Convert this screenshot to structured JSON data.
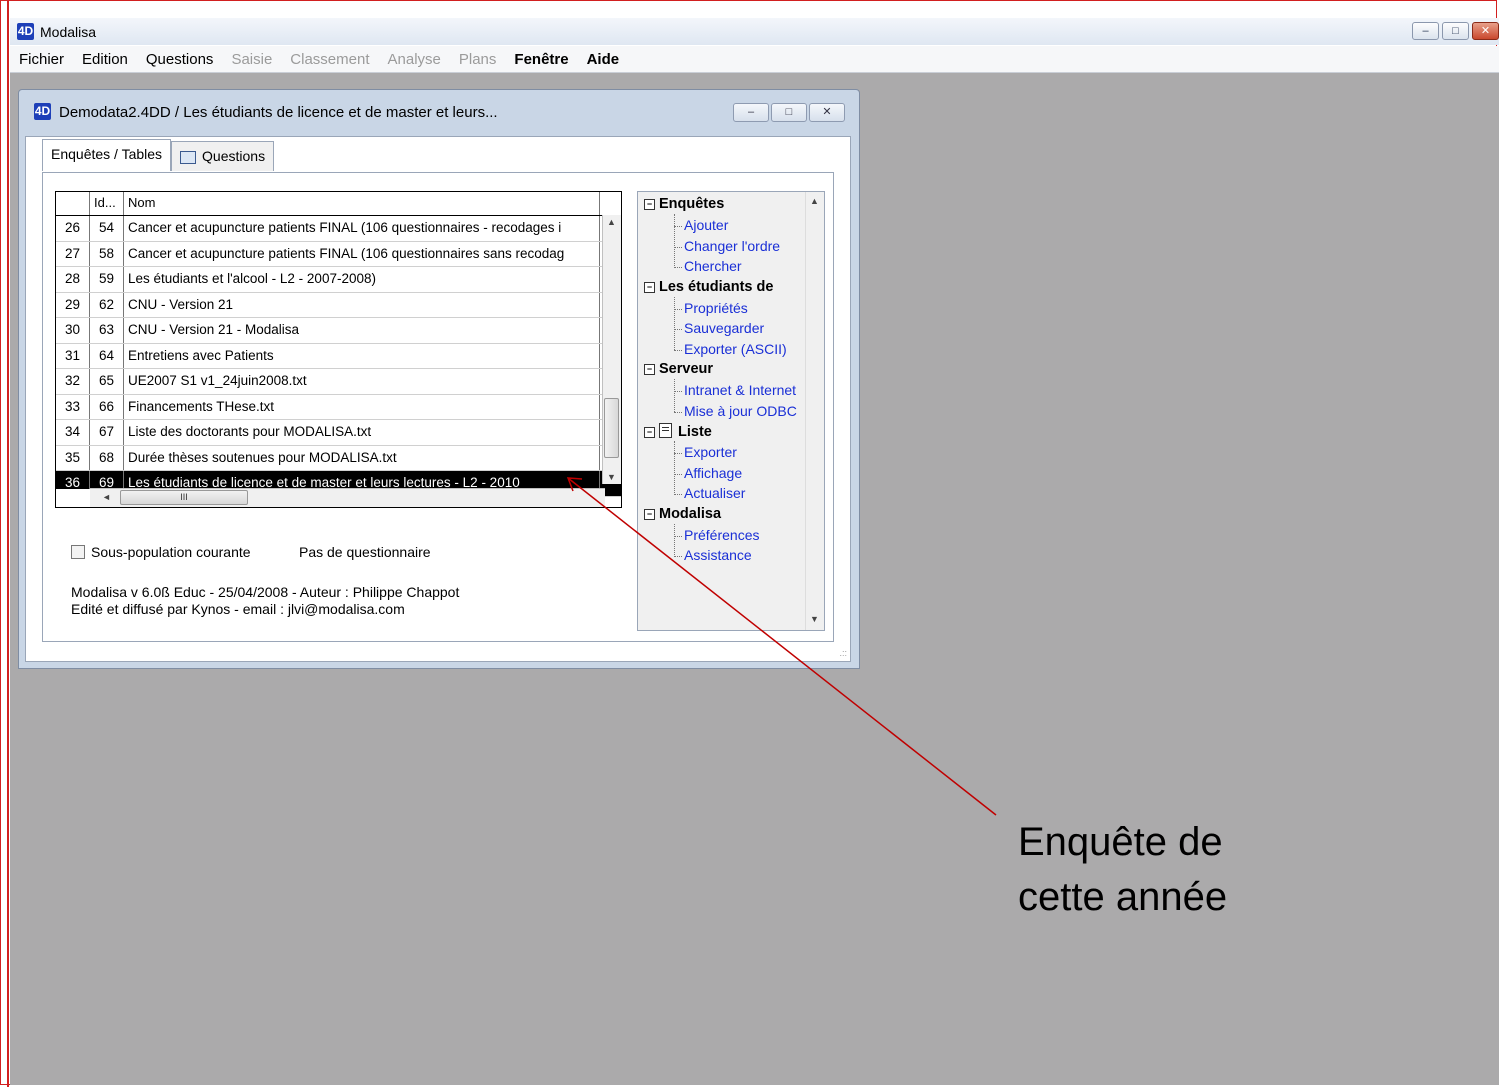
{
  "app": {
    "title": "Modalisa",
    "logo_text": "4D",
    "window_buttons": {
      "minimize": "–",
      "maximize": "□",
      "close": "✕"
    }
  },
  "menu": [
    {
      "label": "Fichier",
      "enabled": true,
      "bold": false
    },
    {
      "label": "Edition",
      "enabled": true,
      "bold": false
    },
    {
      "label": "Questions",
      "enabled": true,
      "bold": false
    },
    {
      "label": "Saisie",
      "enabled": false,
      "bold": false
    },
    {
      "label": "Classement",
      "enabled": false,
      "bold": false
    },
    {
      "label": "Analyse",
      "enabled": false,
      "bold": false
    },
    {
      "label": "Plans",
      "enabled": false,
      "bold": false
    },
    {
      "label": "Fenêtre",
      "enabled": true,
      "bold": true
    },
    {
      "label": "Aide",
      "enabled": true,
      "bold": true
    }
  ],
  "child_window": {
    "title": "Demodata2.4DD / Les étudiants de licence et de master et leurs...",
    "tabs": [
      {
        "label": "Enquêtes / Tables",
        "active": true
      },
      {
        "label": "Questions",
        "active": false
      }
    ]
  },
  "table": {
    "columns": [
      "",
      "Id...",
      "Nom"
    ],
    "rows": [
      {
        "num": "26",
        "id": "54",
        "nom": "Cancer et acupuncture patients FINAL (106 questionnaires - recodages i",
        "selected": false
      },
      {
        "num": "27",
        "id": "58",
        "nom": "Cancer et acupuncture patients FINAL (106 questionnaires sans recodag",
        "selected": false
      },
      {
        "num": "28",
        "id": "59",
        "nom": "Les étudiants et l'alcool - L2 - 2007-2008)",
        "selected": false
      },
      {
        "num": "29",
        "id": "62",
        "nom": "CNU - Version 21",
        "selected": false
      },
      {
        "num": "30",
        "id": "63",
        "nom": "CNU - Version 21 - Modalisa",
        "selected": false
      },
      {
        "num": "31",
        "id": "64",
        "nom": "Entretiens avec Patients",
        "selected": false
      },
      {
        "num": "32",
        "id": "65",
        "nom": "UE2007 S1 v1_24juin2008.txt",
        "selected": false
      },
      {
        "num": "33",
        "id": "66",
        "nom": "Financements THese.txt",
        "selected": false
      },
      {
        "num": "34",
        "id": "67",
        "nom": "Liste des doctorants pour MODALISA.txt",
        "selected": false
      },
      {
        "num": "35",
        "id": "68",
        "nom": "Durée thèses soutenues pour MODALISA.txt",
        "selected": false
      },
      {
        "num": "36",
        "id": "69",
        "nom": "Les étudiants de licence et de master et leurs lectures - L2 - 2010",
        "selected": true
      }
    ],
    "hscroll_grip": "III"
  },
  "tree": {
    "sections": [
      {
        "label": "Enquêtes",
        "items": [
          "Ajouter",
          "Changer l'ordre",
          "Chercher"
        ]
      },
      {
        "label": "Les étudiants de",
        "items": [
          "Propriétés",
          "Sauvegarder",
          "Exporter (ASCII)"
        ]
      },
      {
        "label": "Serveur",
        "items": [
          "Intranet & Internet",
          "Mise à jour ODBC"
        ]
      },
      {
        "label": "Liste",
        "items": [
          "Exporter",
          "Affichage",
          "Actualiser"
        ]
      },
      {
        "label": "Modalisa",
        "items": [
          "Préférences",
          "Assistance"
        ]
      }
    ]
  },
  "footer": {
    "checkbox_label": "Sous-population courante",
    "questionnaire_status": "Pas de questionnaire",
    "version_line": "Modalisa v 6.0ß Educ  -  25/04/2008  -  Auteur : Philippe Chappot",
    "publisher_line": "Edité et diffusé par Kynos  -  email : jlvi@modalisa.com"
  },
  "annotation": {
    "line1": "Enquête de",
    "line2": "cette année",
    "color": "#c00000"
  }
}
